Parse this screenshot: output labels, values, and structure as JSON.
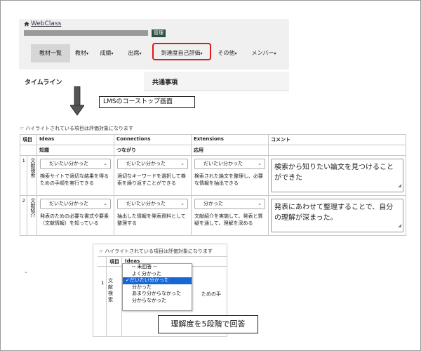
{
  "header": {
    "app_name": "WebClass",
    "admin_badge": "管理",
    "nav": [
      {
        "label": "教材一覧",
        "caret": ""
      },
      {
        "label": "教材",
        "caret": "▾"
      },
      {
        "label": "成績",
        "caret": "▾"
      },
      {
        "label": "出席",
        "caret": "▾"
      },
      {
        "label": "到達度自己評価",
        "caret": "▾"
      },
      {
        "label": "その他",
        "caret": "▾"
      },
      {
        "label": "メンバー",
        "caret": "▾"
      }
    ],
    "highlight_color": "#e01919"
  },
  "main": {
    "timeline_label": "タイムライン",
    "common_label": "共通事項"
  },
  "callouts": {
    "lms_top": "LMSのコーストップ画面",
    "five_levels": "理解度を5段階で回答"
  },
  "evaluation": {
    "hint": "ハイライトされている項目は評価対象になります",
    "col_item": "項目",
    "columns": [
      {
        "title": "Ideas",
        "sub": "知識"
      },
      {
        "title": "Connections",
        "sub": "つながり"
      },
      {
        "title": "Extensions",
        "sub": "応用"
      }
    ],
    "col_comment": "コメント",
    "rows": [
      {
        "num": "1",
        "name": "文献検索",
        "cells": [
          {
            "value": "だいたい分かった",
            "desc": "検索サイトで適切な結果を得るための手順を実行できる"
          },
          {
            "value": "だいたい分かった",
            "desc": "適切なキーワードを選択して検索を繰り返すことができる"
          },
          {
            "value": "だいたい分かった",
            "desc": "検索された論文を整理し、必要な情報を抽出できる"
          }
        ],
        "comment": "検索から知りたい論文を見つけることができた"
      },
      {
        "num": "2",
        "name": "文献紹介",
        "cells": [
          {
            "value": "だいたい分かった",
            "desc": "発表のための必要な書式や要素（文献情報）を知っている"
          },
          {
            "value": "だいたい分かった",
            "desc": "抽出した情報を発表資料として整理する"
          },
          {
            "value": "分かった",
            "desc": "文献紹介を実施して、発表と質疑を通して、理解を深める"
          }
        ],
        "comment": "発表にあわせて整理することで、自分の理解が深まった。"
      }
    ]
  },
  "inset": {
    "hint": "ハイライトされている項目は評価対象になります",
    "col_item": "項目",
    "col_ideas": "Ideas",
    "row_num": "1",
    "row_name": "文献検索",
    "desc_fragment": "ための手",
    "options": [
      "-- 未回答 --",
      "よく分かった",
      "だいたい分かった",
      "分かった",
      "あまり分からなかった",
      "分からなかった"
    ],
    "selected_index": 2,
    "check": "✓",
    "select_color": "#1766d6"
  }
}
